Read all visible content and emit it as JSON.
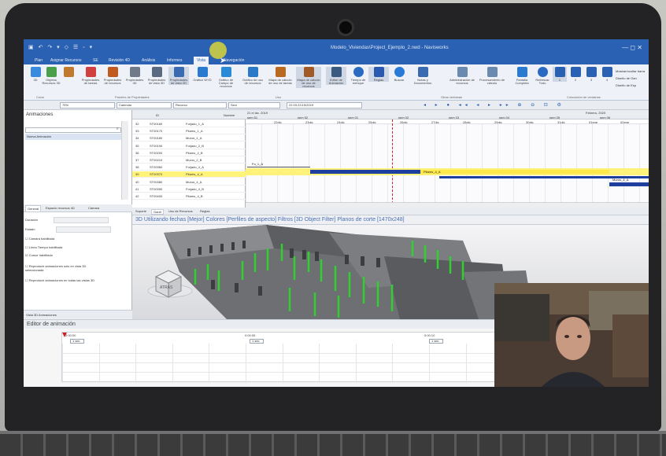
{
  "window": {
    "title": "Modelo_Viviendas\\Project_Ejemplo_2.nwd - Navisworks",
    "quick_access": "▣ ↶ ↷ ▾ ◇ ☰ ◦ ▾",
    "controls": "— ◻ ✕"
  },
  "ribbon_tabs": [
    {
      "label": "Plan"
    },
    {
      "label": "Asignar Recursos"
    },
    {
      "label": "SE"
    },
    {
      "label": "Revisión 4D"
    },
    {
      "label": "Análisis"
    },
    {
      "label": "Informes"
    },
    {
      "label": "Vista"
    },
    {
      "label": "Navegación"
    }
  ],
  "ribbon_buttons": [
    {
      "label": "3D",
      "color": "#3a8ae0"
    },
    {
      "label": "Objetos Recursos 3D",
      "color": "#4aa04a"
    },
    {
      "label": "",
      "color": "#c07a30"
    },
    {
      "label": "Propiedades de tareas",
      "color": "#d04040"
    },
    {
      "label": "Propiedades de recursos",
      "color": "#c05a20"
    },
    {
      "label": "Propiedades 3D",
      "color": "#707a88"
    },
    {
      "label": "Propiedades de vista 3D",
      "color": "#5a6a80"
    },
    {
      "label": "Propiedades de vista 2D",
      "color": "#3a6ab0"
    },
    {
      "label": "Gráfico WYD",
      "color": "#2a7ad0"
    },
    {
      "label": "Gráfico de Campo de recursos",
      "color": "#2a8ad8"
    },
    {
      "label": "Gráfico de uso de recursos",
      "color": "#2a7ac8"
    },
    {
      "label": "Mapa de cálculo de uso de tareas",
      "color": "#b86a20"
    },
    {
      "label": "Mapa de cálculo de uso de recursos",
      "color": "#a05a28"
    },
    {
      "label": "Editor de Animación",
      "color": "#3a5a80"
    },
    {
      "label": "Tiempo de enfoque",
      "color": "#2a6ac0"
    },
    {
      "label": "Reglas",
      "color": "#2a5ab0"
    },
    {
      "label": "Buscar",
      "color": "#2a7ad8"
    },
    {
      "label": "Notas y Documentos",
      "color": "#3a6ab0"
    },
    {
      "label": "Administración de recursos",
      "color": "#6a8ab0"
    },
    {
      "label": "Procesamiento de cálculo",
      "color": "#6a8ab0"
    },
    {
      "label": "Pantalla Completa",
      "color": "#2a7ad0"
    },
    {
      "label": "Refrescar Todo",
      "color": "#2a6ac0"
    },
    {
      "label": "1",
      "color": "#2a61b2"
    },
    {
      "label": "2",
      "color": "#2a61b2"
    },
    {
      "label": "3",
      "color": "#2a61b2"
    },
    {
      "label": "4",
      "color": "#2a61b2"
    }
  ],
  "ribbon_side": [
    "Mostrar/ocultar barra",
    "Diseño de Gan",
    "Diseño de Esp"
  ],
  "ribbon_groups": [
    "Crear",
    "Paneles de Propiedades",
    "Uso",
    "Otras ventanas",
    "Colocación de ventanas"
  ],
  "toolbar": {
    "zoom": "75%",
    "scale": "Calendar",
    "resource": "Recurso",
    "filter": "Sexi",
    "date": "22.03.23:15/2019",
    "icons": "◂ ▸ ● ◂◂ ◂ ▸ ▸▸ ⊕ ⊖ ⊡ ⚙"
  },
  "left_panel": {
    "title": "Animaciones",
    "item": "Nueva Animación",
    "tabs": [
      "General",
      "Espacio recursos 4D",
      "Cámara"
    ],
    "props": [
      "Duración",
      "Estado",
      "Cámara habilitada",
      "Línea Tiempo habilitada",
      "Cursor habilitado",
      "Reproducir animaciones solo en vista 3D seleccionada",
      "Reproducir animaciones en todas las vistas 3D"
    ],
    "bottom": "Vista 3D   Animaciones"
  },
  "gantt": {
    "columns": [
      "",
      "ID",
      "Nombre"
    ],
    "rows": [
      {
        "num": "32",
        "id": "ST00160",
        "name": "Forjado_1_A"
      },
      {
        "num": "33",
        "id": "ST00170",
        "name": "Pilares_1_A"
      },
      {
        "num": "34",
        "id": "ST00180",
        "name": "Muros_1_A"
      },
      {
        "num": "35",
        "id": "ST00190",
        "name": "Forjado_2_B"
      },
      {
        "num": "36",
        "id": "ST00200",
        "name": "Pilares_2_B"
      },
      {
        "num": "37",
        "id": "ST00210",
        "name": "Muros_2_B"
      },
      {
        "num": "38",
        "id": "ST00360",
        "name": "Forjado_4_A"
      },
      {
        "num": "39",
        "id": "ST00370",
        "name": "Pilares_4_A"
      },
      {
        "num": "40",
        "id": "ST00380",
        "name": "Muros_4_A"
      },
      {
        "num": "41",
        "id": "ST00390",
        "name": "Forjado_4_B"
      },
      {
        "num": "42",
        "id": "ST00400",
        "name": "Pilares_4_B"
      }
    ],
    "header_dates_top": [
      "21 el dic. 2019",
      "Febrero, 2020"
    ],
    "header_weeks": [
      "sem 51",
      "sem 52",
      "sem 01",
      "sem 02",
      "sem 03",
      "sem 04",
      "sem 05",
      "sem 06"
    ],
    "header_days": [
      "22dic",
      "23dic",
      "24dic",
      "25dic",
      "26dic",
      "27dic",
      "28dic",
      "29dic",
      "30dic",
      "31dic",
      "01ene",
      "02ene"
    ],
    "bars": {
      "label_a": "Fo_1_A",
      "label_b": "Pilares_4_A",
      "label_c": "Muros_4_A"
    }
  },
  "bottom_tabs": [
    "Soporte",
    "Gantt",
    "Uso de Recursos",
    "Reglas"
  ],
  "view3d_title": "3D Utilizando fechas [Mejor] Colores [Perfiles de aspecto] Filtros [3D Object Filter] Planos de corte [1470x248]",
  "viewcube_label": "ATRÁS",
  "animator": {
    "title": "Editor de animación",
    "times": [
      "0:00:00",
      "0:00:05",
      "0:00:10"
    ],
    "key_label": "1 sec"
  }
}
